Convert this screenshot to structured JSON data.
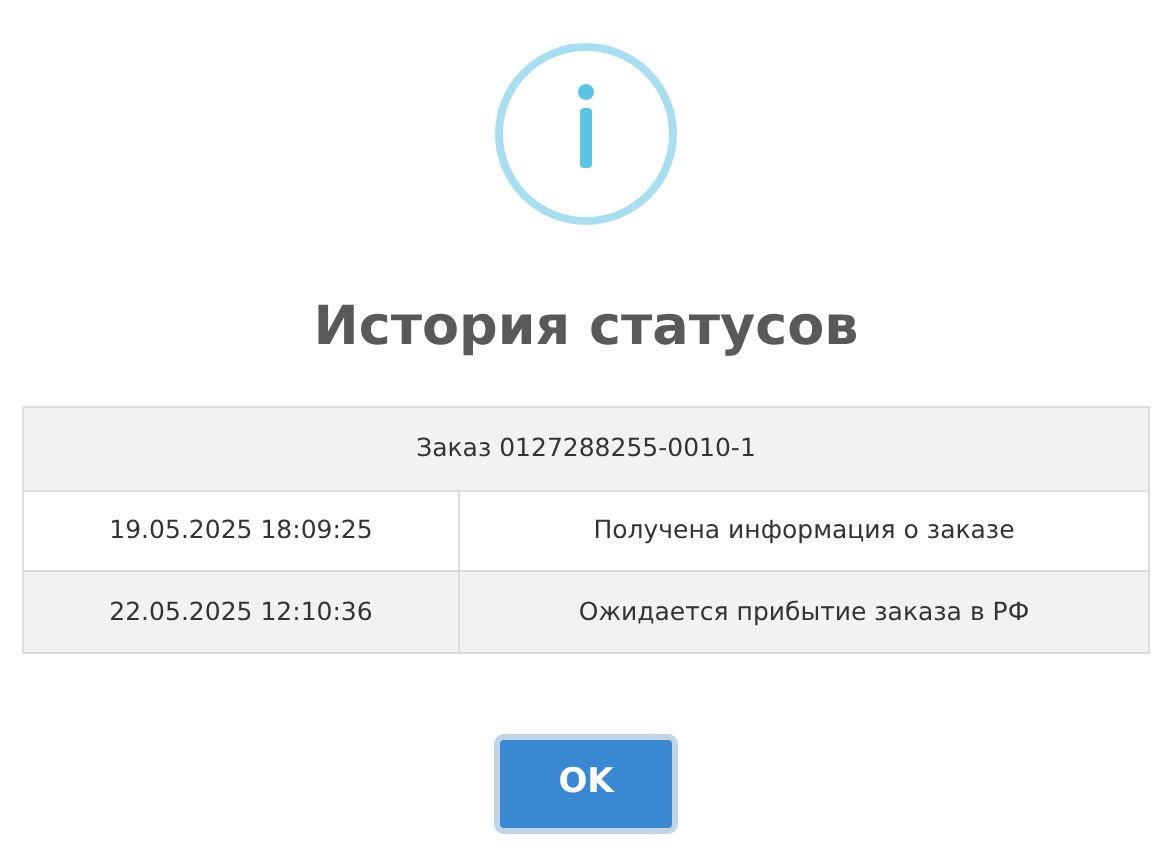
{
  "dialog": {
    "title": "История статусов",
    "table": {
      "header": "Заказ 0127288255-0010-1",
      "rows": [
        {
          "date": "19.05.2025 18:09:25",
          "status": "Получена информация о заказе"
        },
        {
          "date": "22.05.2025 12:10:36",
          "status": "Ожидается прибытие заказа в РФ"
        }
      ]
    },
    "buttons": [
      "OK"
    ]
  }
}
